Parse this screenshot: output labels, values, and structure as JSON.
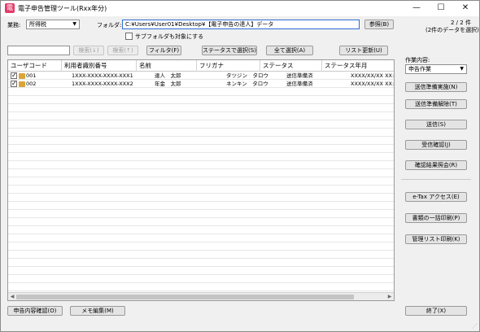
{
  "window": {
    "title": "電子申告管理ツール(Rxx年分)",
    "minimize": "—",
    "maximize": "☐",
    "close": "✕"
  },
  "toolbar": {
    "business_label": "業務:",
    "business_value": "所得税",
    "folder_label": "フォルダ:",
    "folder_value": "C:¥Users¥User01¥Desktop¥【電子申告の達人】データ",
    "browse_button": "参照(B)",
    "page_indicator": "2 / 2 件",
    "selected_count": "(2件のデータを選択)",
    "subfolder_checkbox_label": "サブフォルダも対象にする",
    "subfolder_checked": false
  },
  "filterbar": {
    "search_value": "",
    "search_down_button": "検索(↓)",
    "search_up_button": "検索(↑)",
    "filter_button": "フィルタ(F)",
    "status_select_button": "ステータスで選択(S)",
    "select_all_button": "全て選択(A)",
    "refresh_button": "リスト更新(U)"
  },
  "table": {
    "columns": [
      "ユーザコード",
      "利用者識別番号",
      "名前",
      "フリガナ",
      "ステータス",
      "ステータス年月"
    ],
    "rows": [
      {
        "checked": true,
        "code": "001",
        "id_number": "1XXX-XXXX-XXXX-XXX1",
        "name": "達人　太郎",
        "furigana": "タツジン　タロウ",
        "status": "送信準備済",
        "status_date": "XXXX/XX/XX XX:XX"
      },
      {
        "checked": true,
        "code": "002",
        "id_number": "1XXX-XXXX-XXXX-XXX2",
        "name": "年金　太郎",
        "furigana": "ネンキン　タロウ",
        "status": "送信準備済",
        "status_date": "XXXX/XX/XX XX:XX"
      }
    ]
  },
  "side_panel": {
    "work_content_label": "作業内容:",
    "work_content_value": "申告作業",
    "buttons": {
      "prepare_send": "送信準備実施(N)",
      "cancel_prepare": "送信準備解除(T)",
      "send": "送信(S)",
      "check_receipt": "受信確認(J)",
      "view_results": "確認結果照会(R)",
      "etax_access": "e-Tax アクセス(E)",
      "print_docs": "書類の一括印刷(P)",
      "print_list": "管理リスト印刷(K)",
      "exit": "終了(X)"
    }
  },
  "bottom_bar": {
    "confirm_content_button": "申告内容確認(O)",
    "memo_edit_button": "メモ編集(M)"
  },
  "colors": {
    "window_bg": "#f0f0f0",
    "accent_focus": "#2c6dd1",
    "app_icon": "#e23b6b"
  }
}
